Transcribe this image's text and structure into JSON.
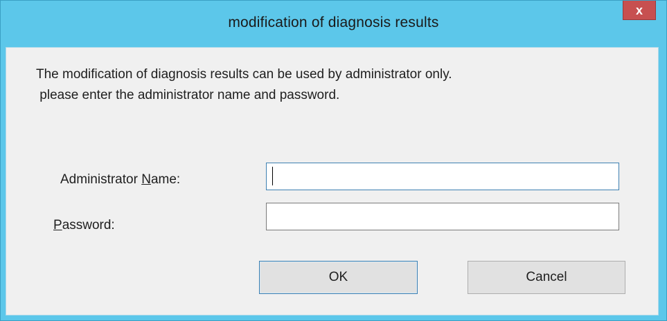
{
  "window": {
    "title": "modification of diagnosis results",
    "close_glyph": "x",
    "titlebar_color": "#5cc7ea",
    "close_color": "#c75050"
  },
  "message": {
    "line1": "The modification of diagnosis results can be used by administrator only.",
    "line2": " please enter the administrator name and password."
  },
  "form": {
    "name_label_before": "Administrator ",
    "name_label_mnemonic": "N",
    "name_label_after": "ame:",
    "name_value": "",
    "password_label_mnemonic": "P",
    "password_label_after": "assword:",
    "password_value": ""
  },
  "buttons": {
    "ok_label": "OK",
    "cancel_label": "Cancel"
  }
}
